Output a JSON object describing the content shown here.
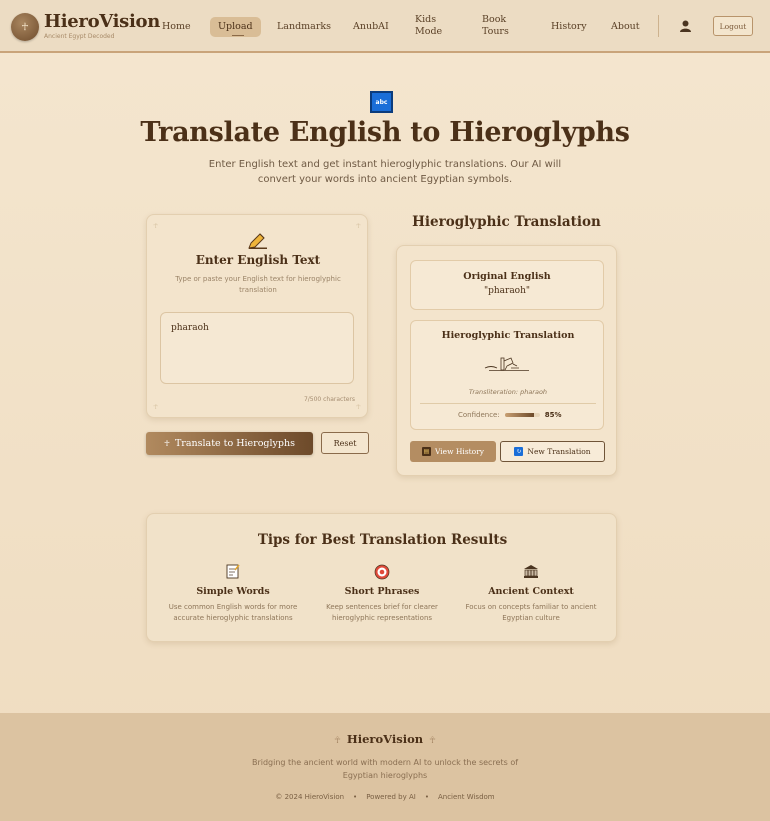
{
  "brand": {
    "name": "HieroVision",
    "tagline": "Ancient Egypt Decoded",
    "logo_icon": "ankh-icon"
  },
  "nav": {
    "items": [
      {
        "label": "Home",
        "active": false
      },
      {
        "label": "Upload",
        "active": true
      },
      {
        "label": "Landmarks",
        "active": false
      },
      {
        "label": "AnubAI",
        "active": false
      },
      {
        "label": "Kids Mode",
        "active": false
      },
      {
        "label": "Book Tours",
        "active": false
      },
      {
        "label": "History",
        "active": false
      },
      {
        "label": "About",
        "active": false
      }
    ],
    "logout_label": "Logout"
  },
  "hero": {
    "icon_label": "abc",
    "title": "Translate English to Hieroglyphs",
    "subtitle": "Enter English text and get instant hieroglyphic translations. Our AI will convert your words into ancient Egyptian symbols."
  },
  "input_card": {
    "title": "Enter English Text",
    "description": "Type or paste your English text for hieroglyphic translation",
    "text_value": "pharaoh",
    "char_count": "7/500 characters",
    "translate_label": "Translate to Hieroglyphs",
    "reset_label": "Reset"
  },
  "result": {
    "heading": "Hieroglyphic Translation",
    "original_label": "Original English",
    "original_value": "\"pharaoh\"",
    "hiero_label": "Hieroglyphic Translation",
    "transliteration": "Transliteration: pharaoh",
    "confidence_label": "Confidence:",
    "confidence_value": "85%",
    "confidence_fraction": 0.85,
    "history_label": "View History",
    "new_label": "New Translation"
  },
  "tips": {
    "title": "Tips for Best Translation Results",
    "items": [
      {
        "icon": "memo-icon",
        "title": "Simple Words",
        "desc": "Use common English words for more accurate hieroglyphic translations"
      },
      {
        "icon": "target-icon",
        "title": "Short Phrases",
        "desc": "Keep sentences brief for clearer hieroglyphic representations"
      },
      {
        "icon": "temple-icon",
        "title": "Ancient Context",
        "desc": "Focus on concepts familiar to ancient Egyptian culture"
      }
    ]
  },
  "footer": {
    "brand": "HieroVision",
    "tagline": "Bridging the ancient world with modern AI to unlock the secrets of Egyptian hieroglyphs",
    "links": [
      "© 2024 HieroVision",
      "Powered by AI",
      "Ancient Wisdom"
    ]
  },
  "colors": {
    "accent": "#6d4a2a",
    "accent_light": "#b48d62",
    "background": "#f4e6cf",
    "text": "#4b3018"
  }
}
